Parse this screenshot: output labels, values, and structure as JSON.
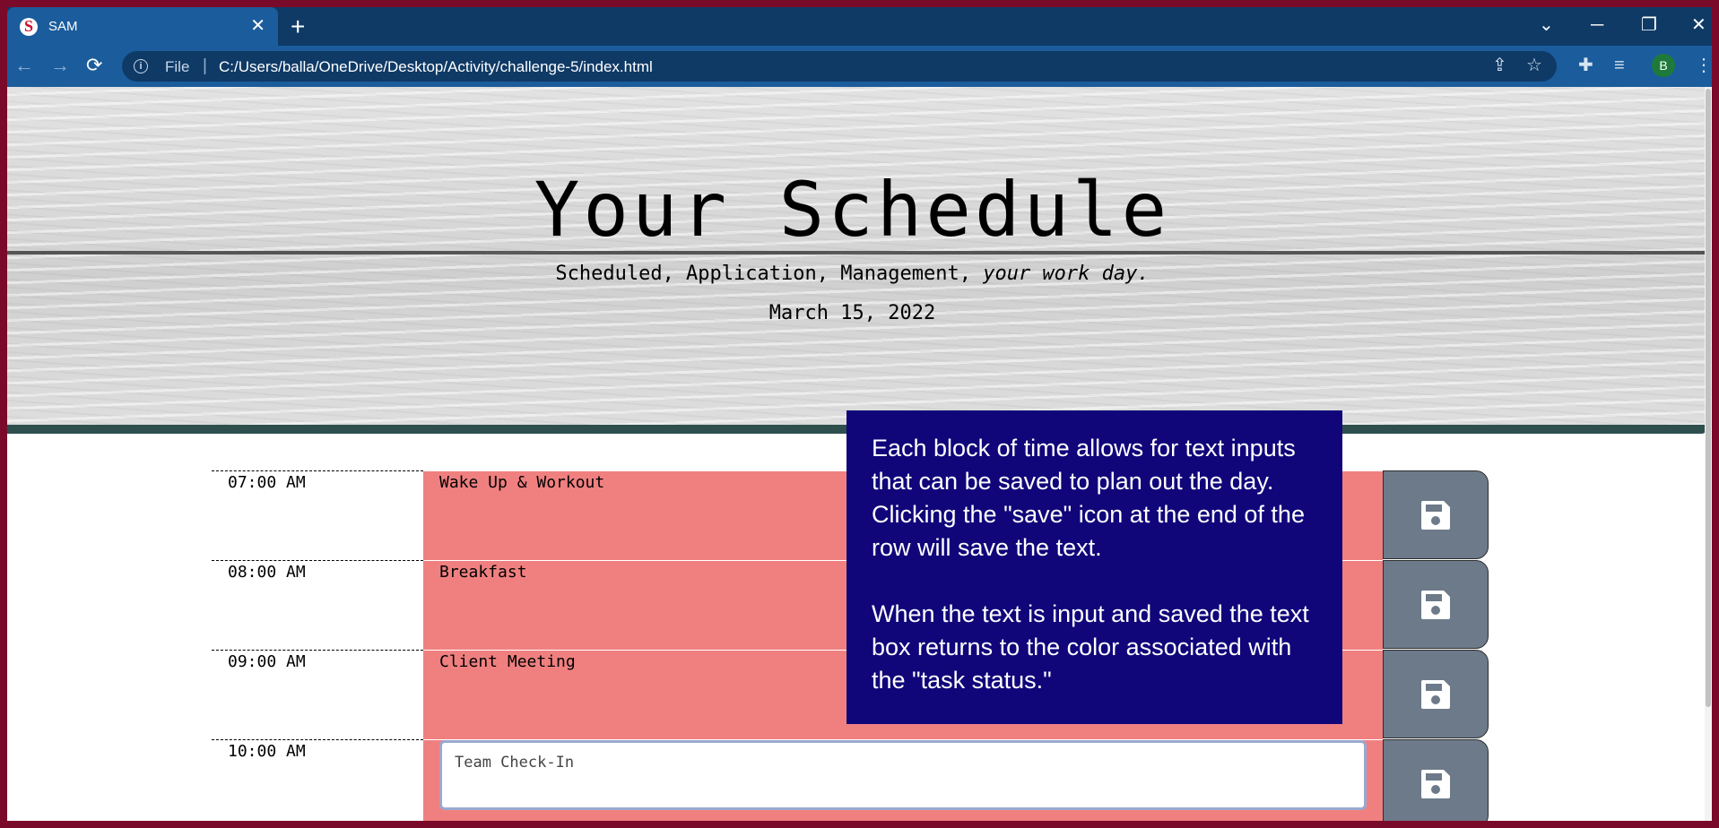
{
  "browser": {
    "tab_title": "SAM",
    "tab_favicon_letter": "S",
    "omnibox_scheme": "File",
    "url": "C:/Users/balla/OneDrive/Desktop/Activity/challenge-5/index.html",
    "profile_initial": "B"
  },
  "header": {
    "title": "Your Schedule",
    "lead_plain": "Scheduled, Application, Management,",
    "lead_italic": "your work day.",
    "date": "March 15, 2022"
  },
  "rows": [
    {
      "hour": "07:00 AM",
      "task": "Wake Up & Workout",
      "status": "past"
    },
    {
      "hour": "08:00 AM",
      "task": "Breakfast",
      "status": "past"
    },
    {
      "hour": "09:00 AM",
      "task": "Client Meeting",
      "status": "past"
    },
    {
      "hour": "10:00 AM",
      "task": "Team Check-In",
      "status": "editing"
    }
  ],
  "tooltip": {
    "paragraph_1": "Each block of time allows for text inputs that can be saved to plan out the day. Clicking the \"save\" icon at the end of the row will save the text.",
    "paragraph_2": "When the text is input and saved the text box returns to the color associated with the \"task status.\""
  },
  "colors": {
    "past_row": "#f08080",
    "save_button": "#6c7a89",
    "tooltip_bg": "#10067a",
    "header_bar": "#2f4f4f"
  },
  "icons": {
    "save": "floppy-disk-icon"
  }
}
